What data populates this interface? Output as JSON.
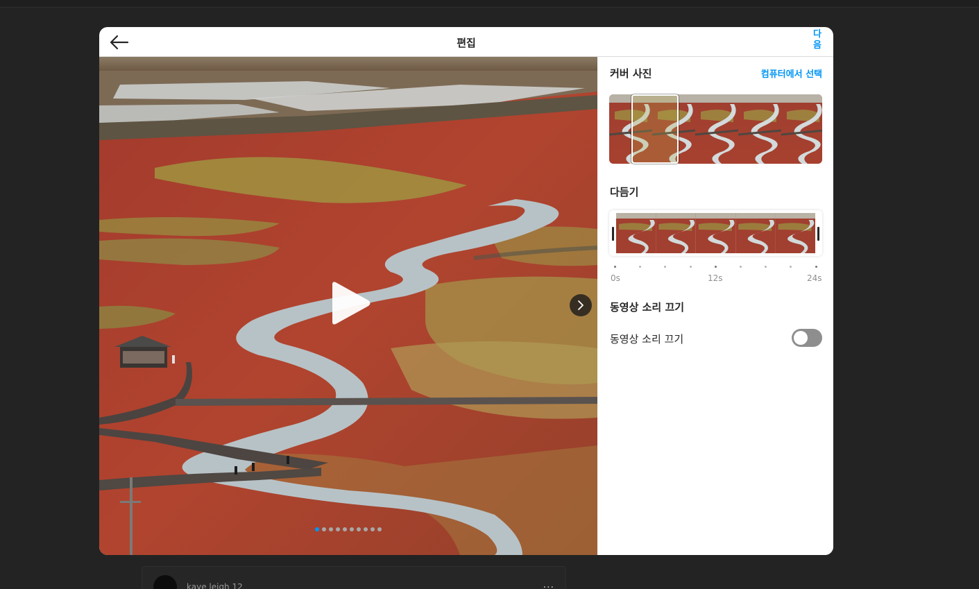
{
  "modal": {
    "title": "편집",
    "next_label": "다음"
  },
  "media": {
    "slide_count": 10,
    "active_slide": 0
  },
  "panel": {
    "cover_title": "커버 사진",
    "cover_link": "컴퓨터에서 선택",
    "trim_title": "다듬기",
    "timeline_labels": [
      "0s",
      "12s",
      "24s"
    ],
    "mute_title": "동영상 소리 끄기",
    "mute_label": "동영상 소리 끄기",
    "mute_on": false
  },
  "feed": {
    "username": "kaye leigh 12",
    "more": "..."
  },
  "colors": {
    "accent": "#0095f6",
    "backdrop": "#232323",
    "toggle_off": "#8e8e8e"
  },
  "icons": {
    "back": "arrow-left-icon",
    "play": "play-icon",
    "next": "chevron-right-icon"
  }
}
